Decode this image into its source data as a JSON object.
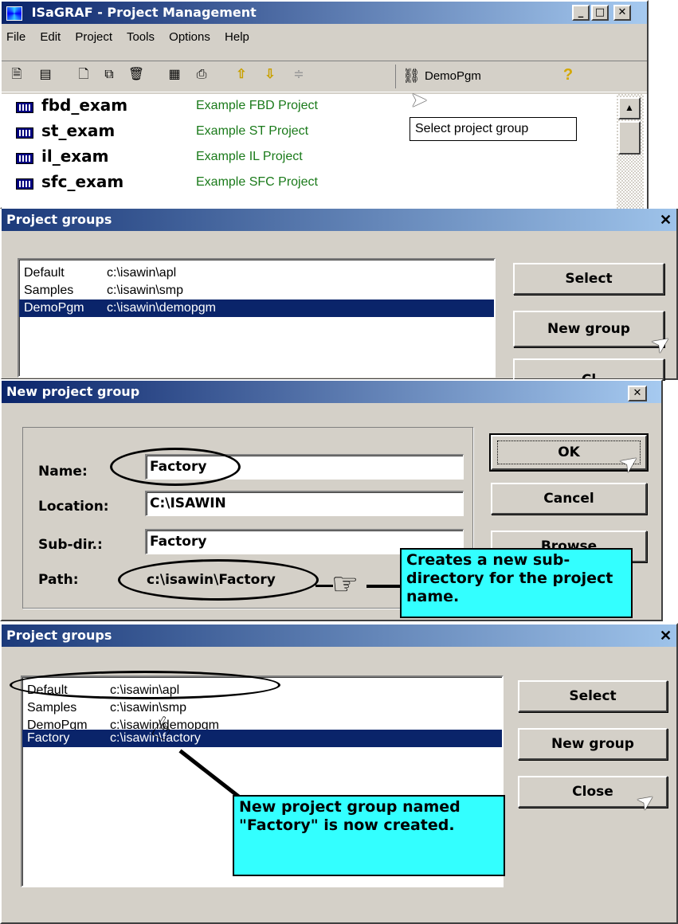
{
  "main_window": {
    "title": "ISaGRAF - Project Management",
    "menu": [
      "File",
      "Edit",
      "Project",
      "Tools",
      "Options",
      "Help"
    ],
    "toolbar": {
      "icons": [
        "project-properties-icon",
        "project-list-icon",
        "new-project-icon",
        "copy-project-icon",
        "delete-project-icon",
        "libraries-icon",
        "print-icon",
        "move-up-icon",
        "move-down-icon",
        "separator-icon"
      ],
      "group_button_label": "DemoPgm",
      "help_icon": "help-icon"
    },
    "tooltip": "Select project group",
    "projects": [
      {
        "name": "fbd_exam",
        "description": "Example FBD Project"
      },
      {
        "name": "st_exam",
        "description": "Example ST Project"
      },
      {
        "name": "il_exam",
        "description": "Example IL Project"
      },
      {
        "name": "sfc_exam",
        "description": "Example SFC Project"
      }
    ]
  },
  "project_groups_1": {
    "title": "Project groups",
    "rows": [
      {
        "name": "Default",
        "path": "c:\\isawin\\apl",
        "selected": false
      },
      {
        "name": "Samples",
        "path": "c:\\isawin\\smp",
        "selected": false
      },
      {
        "name": "DemoPgm",
        "path": "c:\\isawin\\demopgm",
        "selected": true
      }
    ],
    "buttons": {
      "select": "Select",
      "new_group": "New group",
      "close_partial": "Cl"
    }
  },
  "new_group_dialog": {
    "title": "New project group",
    "labels": {
      "name": "Name:",
      "location": "Location:",
      "subdir": "Sub-dir.:",
      "path": "Path:"
    },
    "values": {
      "name": "Factory",
      "location": "C:\\ISAWIN",
      "subdir": "Factory",
      "path": "c:\\isawin\\Factory"
    },
    "buttons": {
      "ok": "OK",
      "cancel": "Cancel",
      "browse": "Browse"
    },
    "callout": "Creates a new sub-directory for the project name."
  },
  "project_groups_2": {
    "title": "Project groups",
    "rows": [
      {
        "name": "Default",
        "path": "c:\\isawin\\apl",
        "selected": false
      },
      {
        "name": "Samples",
        "path": "c:\\isawin\\smp",
        "selected": false
      },
      {
        "name": "DemoPgm",
        "path": "c:\\isawin\\demopgm",
        "selected": false
      },
      {
        "name": "Factory",
        "path": "c:\\isawin\\factory",
        "selected": true
      }
    ],
    "buttons": {
      "select": "Select",
      "new_group": "New group",
      "close": "Close"
    },
    "callout": "New project group named \"Factory\" is now created."
  },
  "colors": {
    "title_active": "#0a246a",
    "face": "#d4d0c8",
    "selection": "#0a246a",
    "callout": "#33ffff",
    "project_desc": "#1a7a1a"
  }
}
